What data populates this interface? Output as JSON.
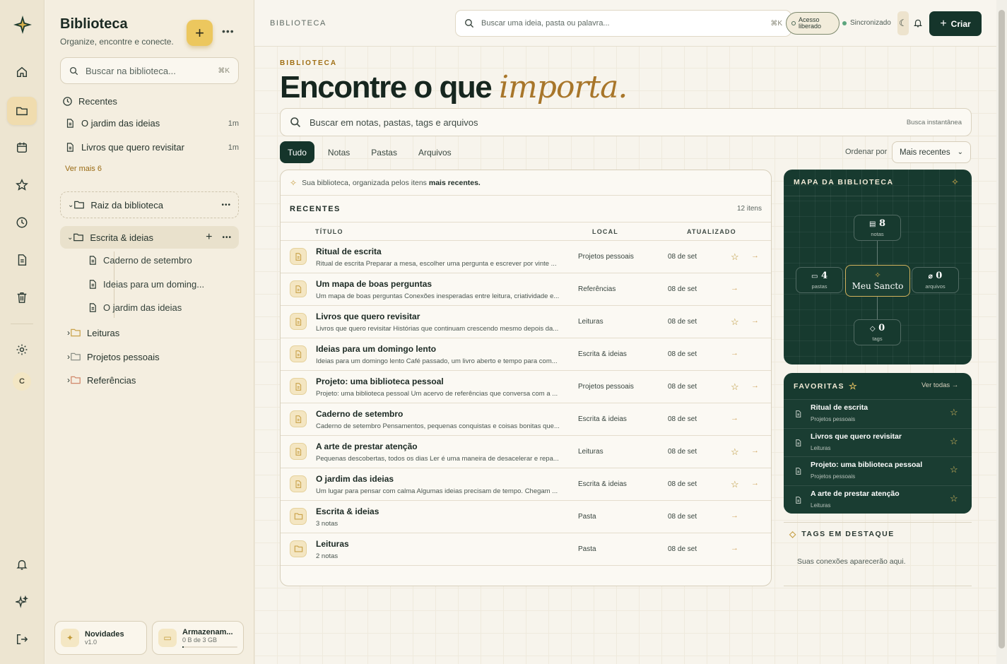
{
  "sidebar": {
    "title": "Biblioteca",
    "subtitle": "Organize, encontre e conecte.",
    "search_placeholder": "Buscar na biblioteca...",
    "search_kbd": "⌘K",
    "recent_heading": "Recentes",
    "recent_items": [
      {
        "label": "O jardim das ideias",
        "meta": "1m"
      },
      {
        "label": "Livros que quero revisitar",
        "meta": "1m"
      }
    ],
    "see_more": "Ver mais 6",
    "root_label": "Raiz da biblioteca",
    "tree": [
      {
        "label": "Escrita & ideias",
        "expanded": true,
        "children": [
          "Caderno de setembro",
          "Ideias para um doming...",
          "O jardim das ideias"
        ]
      },
      {
        "label": "Leituras"
      },
      {
        "label": "Projetos pessoais"
      },
      {
        "label": "Referências"
      }
    ],
    "footer": {
      "news_title": "Novidades",
      "news_sub": "v1.0",
      "storage_title": "Armazenam...",
      "storage_sub": "0 B de 3 GB",
      "storage_used_fraction": 0.0
    },
    "avatar_initial": "C"
  },
  "topbar": {
    "crumb": "BIBLIOTECA",
    "search_placeholder": "Buscar uma ideia, pasta ou palavra...",
    "search_kbd": "⌘K",
    "access_line1": "Acesso",
    "access_line2": "liberado",
    "sync_label": "Sincronizado",
    "create_label": "Criar"
  },
  "hero": {
    "eyebrow": "BIBLIOTECA",
    "title_plain": "Encontre o que",
    "title_accent": "importa."
  },
  "main_search": {
    "placeholder": "Buscar em notas, pastas, tags e arquivos",
    "hint": "Busca instantânea"
  },
  "tabs": [
    "Tudo",
    "Notas",
    "Pastas",
    "Arquivos"
  ],
  "active_tab": "Tudo",
  "sort": {
    "label": "Ordenar por",
    "value": "Mais recentes"
  },
  "list": {
    "intro_prefix": "Sua biblioteca, organizada pelos itens",
    "intro_bold": "mais recentes.",
    "heading": "RECENTES",
    "count": "12 itens",
    "columns": {
      "title": "TÍTULO",
      "location": "LOCAL",
      "updated": "ATUALIZADO"
    },
    "rows": [
      {
        "kind": "note",
        "title": "Ritual de escrita",
        "desc": "Ritual de escrita Preparar a mesa, escolher uma pergunta e escrever por vinte ...",
        "location": "Projetos pessoais",
        "updated": "08 de set",
        "favorite": true
      },
      {
        "kind": "note",
        "title": "Um mapa de boas perguntas",
        "desc": "Um mapa de boas perguntas Conexões inesperadas entre leitura, criatividade e...",
        "location": "Referências",
        "updated": "08 de set",
        "favorite": false
      },
      {
        "kind": "note",
        "title": "Livros que quero revisitar",
        "desc": "Livros que quero revisitar Histórias que continuam crescendo mesmo depois da...",
        "location": "Leituras",
        "updated": "08 de set",
        "favorite": true
      },
      {
        "kind": "note",
        "title": "Ideias para um domingo lento",
        "desc": "Ideias para um domingo lento Café passado, um livro aberto e tempo para com...",
        "location": "Escrita & ideias",
        "updated": "08 de set",
        "favorite": false
      },
      {
        "kind": "note",
        "title": "Projeto: uma biblioteca pessoal",
        "desc": "Projeto: uma biblioteca pessoal Um acervo de referências que conversa com a ...",
        "location": "Projetos pessoais",
        "updated": "08 de set",
        "favorite": true
      },
      {
        "kind": "note",
        "title": "Caderno de setembro",
        "desc": "Caderno de setembro Pensamentos, pequenas conquistas e coisas bonitas que...",
        "location": "Escrita & ideias",
        "updated": "08 de set",
        "favorite": false
      },
      {
        "kind": "note",
        "title": "A arte de prestar atenção",
        "desc": "Pequenas descobertas, todos os dias Ler é uma maneira de desacelerar e repa...",
        "location": "Leituras",
        "updated": "08 de set",
        "favorite": true
      },
      {
        "kind": "note",
        "title": "O jardim das ideias",
        "desc": "Um lugar para pensar com calma Algumas ideias precisam de tempo. Chegam ...",
        "location": "Escrita & ideias",
        "updated": "08 de set",
        "favorite": true
      },
      {
        "kind": "folder",
        "title": "Escrita & ideias",
        "desc": "3 notas",
        "location": "Pasta",
        "updated": "08 de set",
        "favorite": false
      },
      {
        "kind": "folder",
        "title": "Leituras",
        "desc": "2 notas",
        "location": "Pasta",
        "updated": "08 de set",
        "favorite": false
      }
    ]
  },
  "map": {
    "heading": "MAPA DA BIBLIOTECA",
    "center": "Meu Sancto",
    "notes": {
      "value": "8",
      "label": "notas"
    },
    "folders": {
      "value": "4",
      "label": "pastas"
    },
    "files": {
      "value": "0",
      "label": "arquivos"
    },
    "tags": {
      "value": "0",
      "label": "tags"
    }
  },
  "favorites": {
    "heading": "FAVORITAS",
    "see_all": "Ver todas",
    "items": [
      {
        "title": "Ritual de escrita",
        "sub": "Projetos pessoais"
      },
      {
        "title": "Livros que quero revisitar",
        "sub": "Leituras"
      },
      {
        "title": "Projeto: uma biblioteca pessoal",
        "sub": "Projetos pessoais"
      },
      {
        "title": "A arte de prestar atenção",
        "sub": "Leituras"
      }
    ]
  },
  "tags": {
    "heading": "TAGS EM DESTAQUE",
    "empty": "Suas conexões aparecerão aqui."
  },
  "colors": {
    "accent_dark_green": "#15352b",
    "accent_gold": "#ecc75e",
    "accent_text_gold": "#a8762a"
  }
}
